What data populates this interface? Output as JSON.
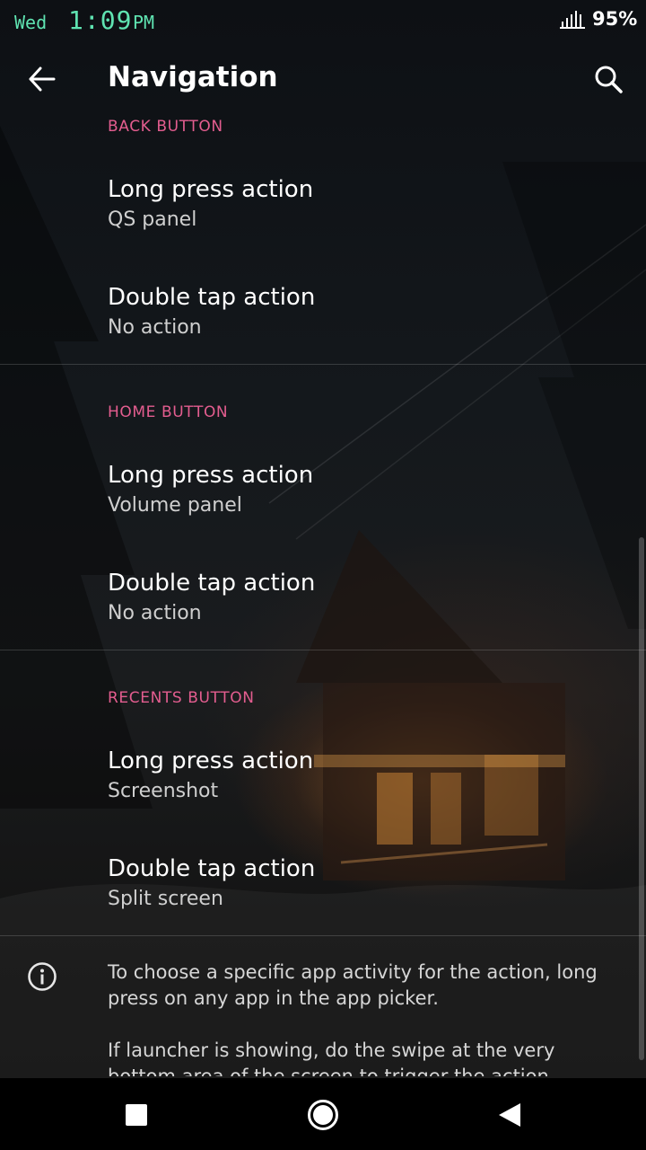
{
  "status_bar": {
    "day": "Wed",
    "time": "1:09",
    "ampm": "PM",
    "battery": "95%",
    "icons": [
      "signal-icon"
    ]
  },
  "app_bar": {
    "title": "Navigation",
    "icons": [
      "back-arrow-icon",
      "search-icon"
    ]
  },
  "sections": [
    {
      "header": "BACK BUTTON",
      "items": [
        {
          "title": "Long press action",
          "value": "QS panel"
        },
        {
          "title": "Double tap action",
          "value": "No action"
        }
      ]
    },
    {
      "header": "HOME BUTTON",
      "items": [
        {
          "title": "Long press action",
          "value": "Volume panel"
        },
        {
          "title": "Double tap action",
          "value": "No action"
        }
      ]
    },
    {
      "header": "RECENTS BUTTON",
      "items": [
        {
          "title": "Long press action",
          "value": "Screenshot"
        },
        {
          "title": "Double tap action",
          "value": "Split screen"
        }
      ]
    }
  ],
  "info": {
    "icon": "info-icon",
    "paragraph_1": "To choose a specific app activity for the action, long press on any app in the app picker.",
    "paragraph_2": "If launcher is showing, do the swipe at the very bottom area of the screen to trigger the action."
  },
  "nav_bar": {
    "icons": [
      "recents-square-icon",
      "home-circle-icon",
      "back-triangle-icon"
    ]
  },
  "colors": {
    "accent": "#e35d8f",
    "clock": "#5fe3b1",
    "text_primary": "#ffffff",
    "text_secondary": "#cfcfcf"
  }
}
